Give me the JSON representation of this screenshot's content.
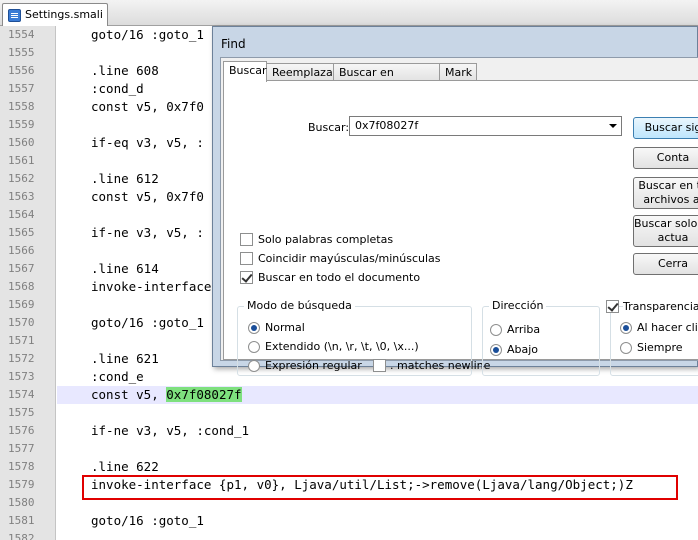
{
  "editor": {
    "tab_label": "Settings.smali",
    "tab_icon": "file-icon",
    "highlight_color": "#7ee07e",
    "lines": [
      {
        "num": "1554",
        "text": "goto/16 :goto_1"
      },
      {
        "num": "1555",
        "text": ""
      },
      {
        "num": "1556",
        "text": ".line 608"
      },
      {
        "num": "1557",
        "text": ":cond_d"
      },
      {
        "num": "1558",
        "text": "const v5, 0x7f0"
      },
      {
        "num": "1559",
        "text": ""
      },
      {
        "num": "1560",
        "text": "if-eq v3, v5, :"
      },
      {
        "num": "1561",
        "text": ""
      },
      {
        "num": "1562",
        "text": ".line 612"
      },
      {
        "num": "1563",
        "text": "const v5, 0x7f0"
      },
      {
        "num": "1564",
        "text": ""
      },
      {
        "num": "1565",
        "text": "if-ne v3, v5, :"
      },
      {
        "num": "1566",
        "text": ""
      },
      {
        "num": "1567",
        "text": ".line 614"
      },
      {
        "num": "1568",
        "text": "invoke-interface"
      },
      {
        "num": "1569",
        "text": ""
      },
      {
        "num": "1570",
        "text": "goto/16 :goto_1"
      },
      {
        "num": "1571",
        "text": ""
      },
      {
        "num": "1572",
        "text": ".line 621"
      },
      {
        "num": "1573",
        "text": ":cond_e"
      },
      {
        "num": "1574",
        "text_before": "const v5, ",
        "text_match": "0x7f08027f"
      },
      {
        "num": "1575",
        "text": ""
      },
      {
        "num": "1576",
        "text": "if-ne v3, v5, :cond_1"
      },
      {
        "num": "1577",
        "text": ""
      },
      {
        "num": "1578",
        "text": ".line 622"
      },
      {
        "num": "1579",
        "text": "invoke-interface {p1, v0}, Ljava/util/List;->remove(Ljava/lang/Object;)Z"
      },
      {
        "num": "1580",
        "text": ""
      },
      {
        "num": "1581",
        "text": "goto/16 :goto_1"
      },
      {
        "num": "1582",
        "text": ""
      }
    ]
  },
  "find_dialog": {
    "title": "Find",
    "tabs": [
      "Buscar",
      "Reemplazar",
      "Buscar en archivos",
      "Mark"
    ],
    "search_label": "Buscar:",
    "search_value": "0x7f08027f",
    "buttons": {
      "find_next": "Buscar sig",
      "count": "Conta",
      "find_all_open_1": "Buscar en to",
      "find_all_open_2": "archivos al",
      "find_all_current_1": "Buscar solo en",
      "find_all_current_2": "actua",
      "close": "Cerra"
    },
    "options": {
      "whole_word": "Solo palabras completas",
      "match_case": "Coincidir mayúsculas/minúsculas",
      "wrap_around": "Buscar en todo el documento"
    },
    "search_mode": {
      "title": "Modo de búsqueda",
      "normal": "Normal",
      "extended": "Extendido (\\n, \\r, \\t, \\0, \\x...)",
      "regex": "Expresión regular",
      "matches_newline": ". matches newline"
    },
    "direction": {
      "title": "Dirección",
      "up": "Arriba",
      "down": "Abajo"
    },
    "transparency": {
      "title": "Transparencia",
      "on_lose_focus": "Al hacer clic s",
      "always": "Siempre"
    }
  }
}
